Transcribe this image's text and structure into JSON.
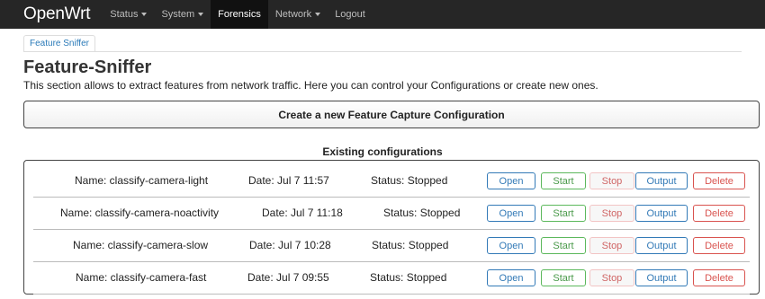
{
  "navbar": {
    "brand": "OpenWrt",
    "items": [
      {
        "label": "Status",
        "dropdown": true
      },
      {
        "label": "System",
        "dropdown": true
      },
      {
        "label": "Forensics",
        "dropdown": false,
        "active": true
      },
      {
        "label": "Network",
        "dropdown": true
      },
      {
        "label": "Logout",
        "dropdown": false
      }
    ]
  },
  "tabs": [
    {
      "label": "Feature Sniffer"
    }
  ],
  "page": {
    "title": "Feature-Sniffer",
    "description": "This section allows to extract features from network traffic. Here you can control your Configurations or create new ones."
  },
  "create_button": "Create a new Feature Capture Configuration",
  "section_title": "Existing configurations",
  "configurations": [
    {
      "name": "Name: classify-camera-light",
      "date": "Date: Jul 7 11:57",
      "status": "Status: Stopped"
    },
    {
      "name": "Name: classify-camera-noactivity",
      "date": "Date: Jul 7 11:18",
      "status": "Status: Stopped"
    },
    {
      "name": "Name: classify-camera-slow",
      "date": "Date: Jul 7 10:28",
      "status": "Status: Stopped"
    },
    {
      "name": "Name: classify-camera-fast",
      "date": "Date: Jul 7 09:55",
      "status": "Status: Stopped"
    }
  ],
  "row_buttons": {
    "open": "Open",
    "start": "Start",
    "stop": "Stop",
    "output": "Output",
    "delete": "Delete"
  }
}
